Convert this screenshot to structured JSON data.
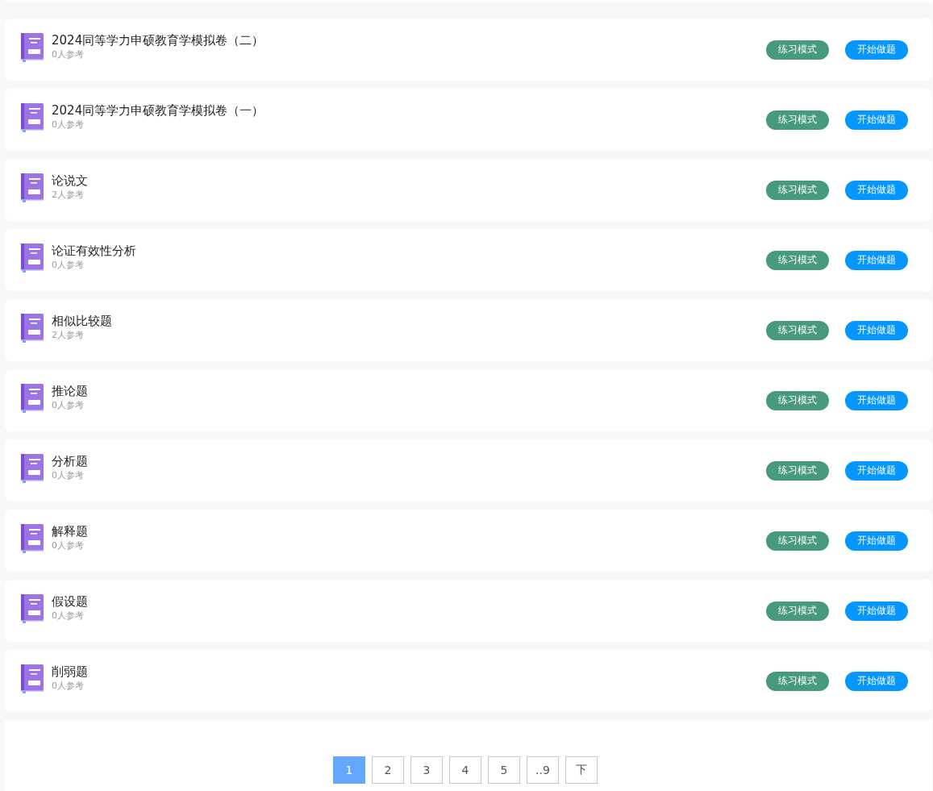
{
  "papers": [
    {
      "title": "2024同等学力申硕教育学模拟卷（二）",
      "participants": "0人参考",
      "practice_button": "练习模式",
      "start_button": "开始做题"
    },
    {
      "title": "2024同等学力申硕教育学模拟卷（一）",
      "participants": "0人参考",
      "practice_button": "练习模式",
      "start_button": "开始做题"
    },
    {
      "title": "论说文",
      "participants": "2人参考",
      "practice_button": "练习模式",
      "start_button": "开始做题"
    },
    {
      "title": "论证有效性分析",
      "participants": "0人参考",
      "practice_button": "练习模式",
      "start_button": "开始做题"
    },
    {
      "title": "相似比较题",
      "participants": "2人参考",
      "practice_button": "练习模式",
      "start_button": "开始做题"
    },
    {
      "title": "推论题",
      "participants": "0人参考",
      "practice_button": "练习模式",
      "start_button": "开始做题"
    },
    {
      "title": "分析题",
      "participants": "0人参考",
      "practice_button": "练习模式",
      "start_button": "开始做题"
    },
    {
      "title": "解释题",
      "participants": "0人参考",
      "practice_button": "练习模式",
      "start_button": "开始做题"
    },
    {
      "title": "假设题",
      "participants": "0人参考",
      "practice_button": "练习模式",
      "start_button": "开始做题"
    },
    {
      "title": "削弱题",
      "participants": "0人参考",
      "practice_button": "练习模式",
      "start_button": "开始做题"
    }
  ],
  "pagination": [
    {
      "label": "1",
      "selected": true
    },
    {
      "label": "2",
      "selected": false
    },
    {
      "label": "3",
      "selected": false
    },
    {
      "label": "4",
      "selected": false
    },
    {
      "label": "5",
      "selected": false
    },
    {
      "label": "..9",
      "selected": false
    },
    {
      "label": "下",
      "selected": false
    }
  ]
}
